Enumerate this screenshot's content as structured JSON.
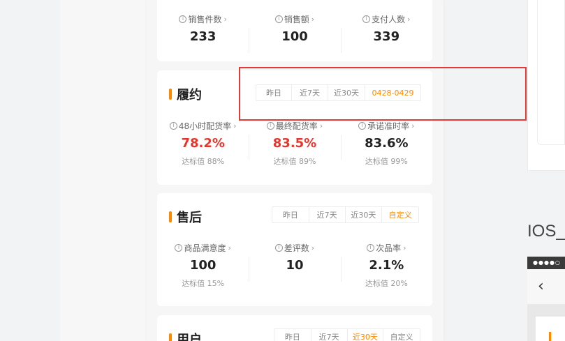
{
  "sales": {
    "metrics": [
      {
        "label": "销售件数",
        "value": "233"
      },
      {
        "label": "销售额",
        "value": "100"
      },
      {
        "label": "支付人数",
        "value": "339"
      }
    ]
  },
  "fulfillment": {
    "title": "履约",
    "ranges": [
      "昨日",
      "近7天",
      "近30天",
      "0428-0429"
    ],
    "active_range": 3,
    "metrics": [
      {
        "label": "48小时配货率",
        "value": "78.2%",
        "target": "达标值 88%"
      },
      {
        "label": "最终配货率",
        "value": "83.5%",
        "target": "达标值 89%"
      },
      {
        "label": "承诺准时率",
        "value": "83.6%",
        "target": "达标值 99%"
      }
    ]
  },
  "aftersale": {
    "title": "售后",
    "ranges": [
      "昨日",
      "近7天",
      "近30天",
      "自定义"
    ],
    "active_range": 3,
    "metrics": [
      {
        "label": "商品满意度",
        "value": "100",
        "target": "达标值 15%"
      },
      {
        "label": "差评数",
        "value": "10",
        "target": ""
      },
      {
        "label": "次品率",
        "value": "2.1%",
        "target": "达标值 20%"
      }
    ]
  },
  "users": {
    "title": "用户",
    "ranges": [
      "昨日",
      "近7天",
      "近30天",
      "自定义"
    ],
    "active_range": 2
  },
  "right_panel": {
    "label": "IOS_",
    "status_dots": "●●●●○",
    "back_glyph": "‹"
  },
  "icons": {
    "info": "i",
    "chevron": "›"
  },
  "colors": {
    "accent": "#ff8a00",
    "alert": "#e8352b",
    "highlight_box": "#e53935"
  }
}
